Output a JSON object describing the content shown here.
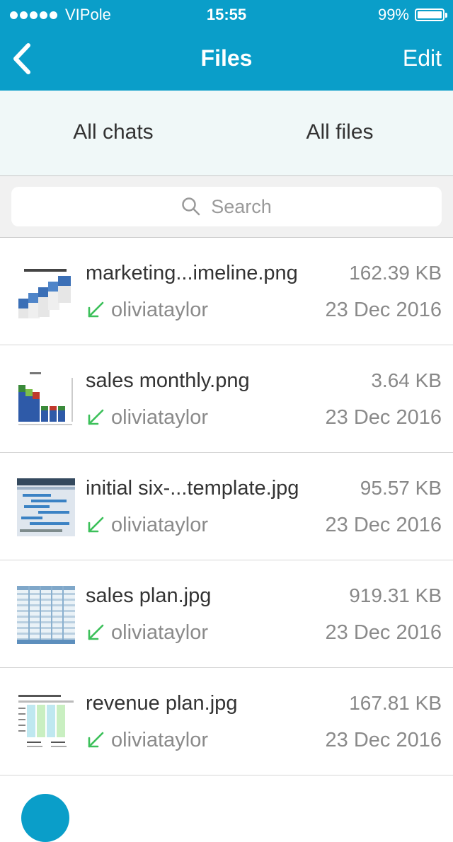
{
  "status_bar": {
    "carrier": "VIPole",
    "time": "15:55",
    "battery_percent": "99%"
  },
  "nav": {
    "title": "Files",
    "back_icon": "chevron-left-icon",
    "edit_label": "Edit"
  },
  "tabs": [
    {
      "label": "All chats"
    },
    {
      "label": "All files"
    }
  ],
  "search": {
    "placeholder": "Search"
  },
  "files": [
    {
      "name": "marketing...imeline.png",
      "size": "162.39 KB",
      "user": "oliviataylor",
      "date": "23 Dec 2016",
      "thumb": "timeline"
    },
    {
      "name": "sales monthly.png",
      "size": "3.64 KB",
      "user": "oliviataylor",
      "date": "23 Dec 2016",
      "thumb": "bar-chart"
    },
    {
      "name": "initial six-...template.jpg",
      "size": "95.57 KB",
      "user": "oliviataylor",
      "date": "23 Dec 2016",
      "thumb": "plan"
    },
    {
      "name": "sales plan.jpg",
      "size": "919.31 KB",
      "user": "oliviataylor",
      "date": "23 Dec 2016",
      "thumb": "spreadsheet"
    },
    {
      "name": "revenue plan.jpg",
      "size": "167.81 KB",
      "user": "oliviataylor",
      "date": "23 Dec 2016",
      "thumb": "revenue"
    }
  ],
  "colors": {
    "accent": "#0a9ec9",
    "received_arrow": "#3cc05a",
    "tab_background": "#f0f8f8"
  }
}
